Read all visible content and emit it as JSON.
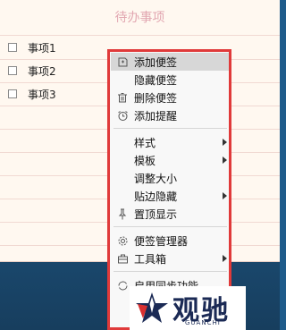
{
  "note": {
    "title": "待办事项",
    "tasks": [
      "事项1",
      "事项2",
      "事项3"
    ]
  },
  "menu": {
    "items": [
      {
        "label": "添加便签",
        "icon": "note-add-icon",
        "submenu": false,
        "highlighted": true
      },
      {
        "label": "隐藏便签",
        "icon": "",
        "submenu": false,
        "highlighted": false
      },
      {
        "label": "删除便签",
        "icon": "trash-icon",
        "submenu": false,
        "highlighted": false
      },
      {
        "label": "添加提醒",
        "icon": "alarm-clock-icon",
        "submenu": false,
        "highlighted": false
      },
      {
        "label": "样式",
        "icon": "",
        "submenu": true,
        "highlighted": false
      },
      {
        "label": "模板",
        "icon": "",
        "submenu": true,
        "highlighted": false
      },
      {
        "label": "调整大小",
        "icon": "",
        "submenu": false,
        "highlighted": false
      },
      {
        "label": "贴边隐藏",
        "icon": "",
        "submenu": true,
        "highlighted": false
      },
      {
        "label": "置顶显示",
        "icon": "pin-icon",
        "submenu": false,
        "highlighted": false
      },
      {
        "label": "便签管理器",
        "icon": "gear-icon",
        "submenu": false,
        "highlighted": false
      },
      {
        "label": "工具箱",
        "icon": "toolbox-icon",
        "submenu": true,
        "highlighted": false
      },
      {
        "label": "启用同步功能",
        "icon": "sync-icon",
        "submenu": false,
        "highlighted": false
      }
    ]
  },
  "watermark": {
    "text": "观驰",
    "sub": "GUANCHI"
  },
  "colors": {
    "highlight_border": "#e03a3a",
    "menu_bg": "#f8f8f8",
    "note_bg": "#fff8f0",
    "title_color": "#e2a7b1"
  }
}
